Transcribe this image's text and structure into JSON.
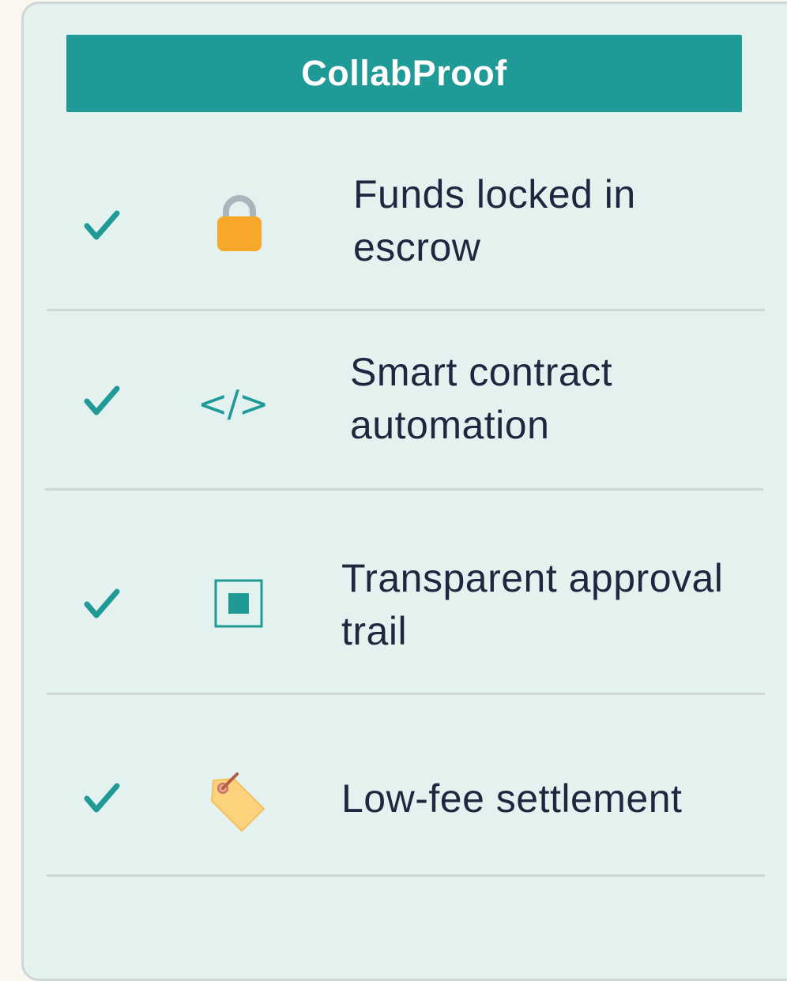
{
  "header": {
    "title": "CollabProof"
  },
  "features": [
    {
      "label_line1": "Funds locked in",
      "label_line2": "escrow",
      "icon": "lock-icon"
    },
    {
      "label_line1": "Smart contract",
      "label_line2": "automation",
      "icon": "code-icon",
      "icon_text": "</>"
    },
    {
      "label_line1": "Transparent approval",
      "label_line2": "trail",
      "icon": "ballot-box-icon"
    },
    {
      "label_line1": "Low-fee settlement",
      "label_line2": "",
      "icon": "price-tag-icon"
    }
  ],
  "colors": {
    "accent": "#1f9a97",
    "card_background": "#e4f2ef",
    "text": "#1e2740",
    "divider": "#cfd6d6"
  }
}
